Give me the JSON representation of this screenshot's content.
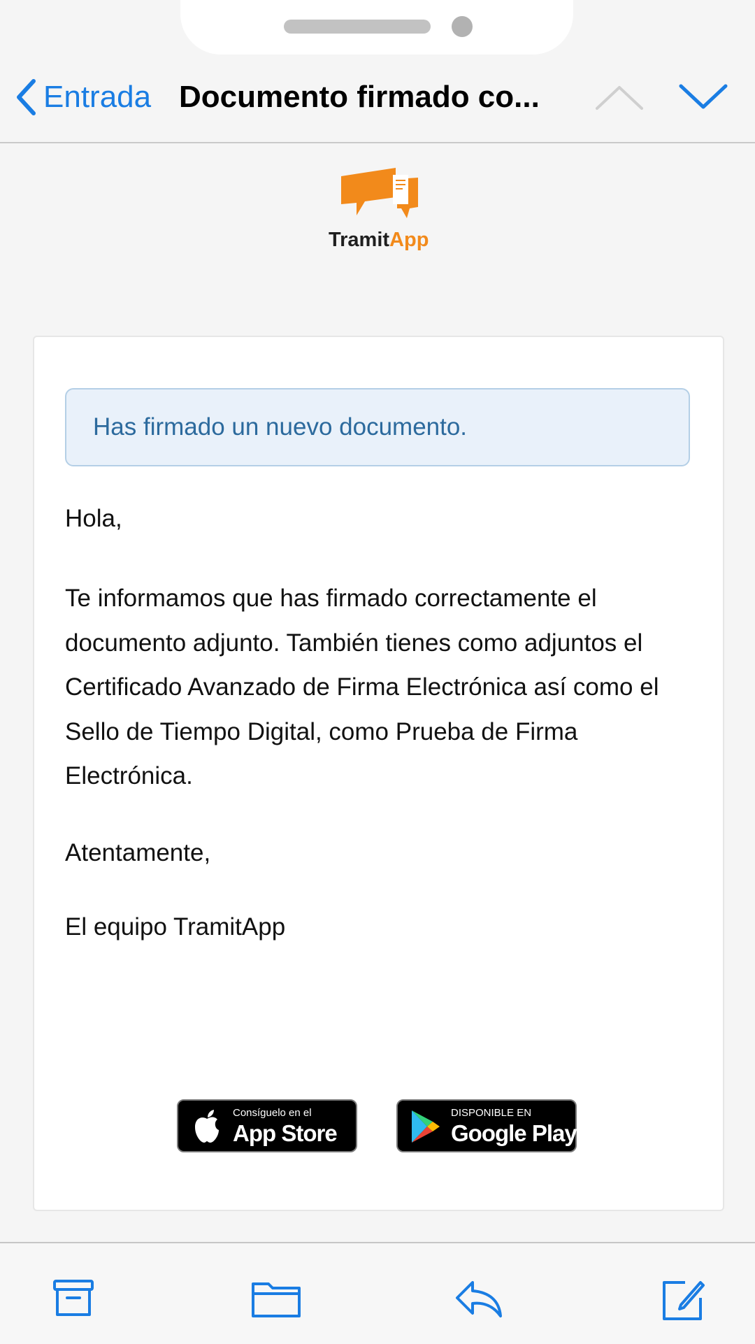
{
  "nav": {
    "back_label": "Entrada",
    "title": "Documento firmado co..."
  },
  "logo": {
    "part1": "Tramit",
    "part2": "App"
  },
  "email": {
    "banner": "Has firmado un nuevo documento.",
    "greeting": "Hola,",
    "body": "Te informamos que has firmado correctamente el documento adjunto. También tienes como adjuntos el Certificado Avanzado de Firma Electrónica así como el Sello de Tiempo Digital, como Prueba de Firma Electrónica.",
    "closing": "Atentamente,",
    "signature": "El equipo TramitApp"
  },
  "badges": {
    "apple_small": "Consíguelo en el",
    "apple_big": "App Store",
    "google_small": "DISPONIBLE EN",
    "google_big": "Google Play"
  },
  "colors": {
    "accent": "#1a7de3",
    "brand_orange": "#f28a1b",
    "banner_text": "#2c6a9d"
  },
  "toolbar_icons": [
    "archive-icon",
    "folder-icon",
    "reply-icon",
    "compose-icon"
  ]
}
